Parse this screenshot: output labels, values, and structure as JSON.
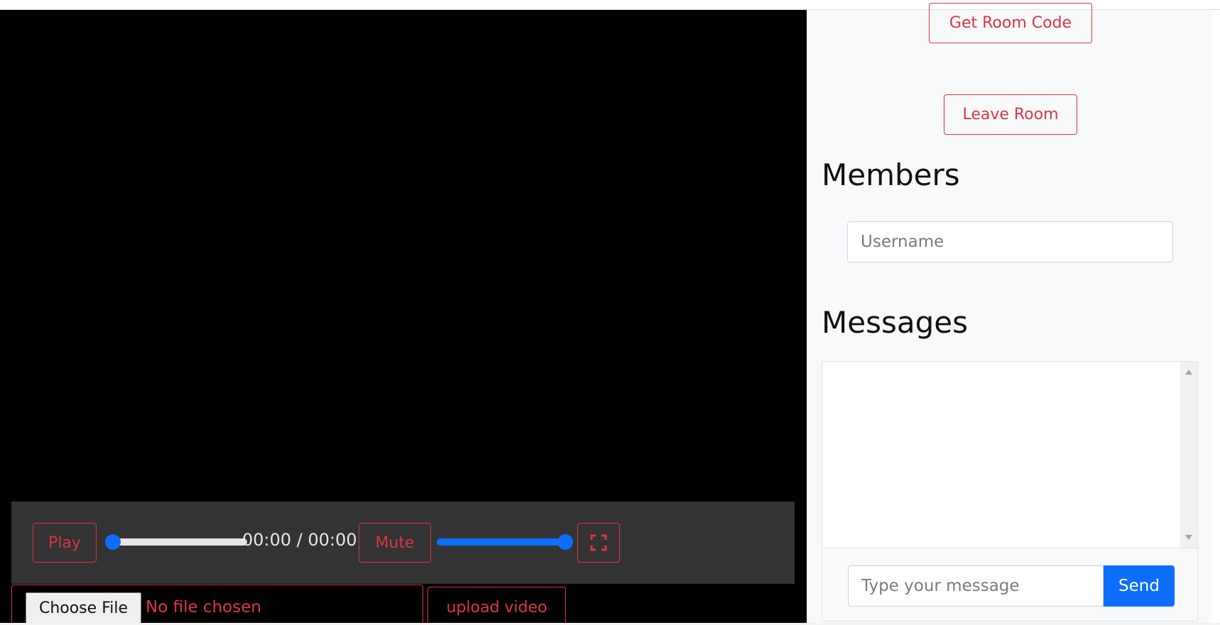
{
  "player": {
    "play_label": "Play",
    "time_display": "00:00 / 00:00",
    "mute_label": "Mute",
    "seek_progress": 0,
    "volume_level": 1.0,
    "fullscreen_icon": "fullscreen-icon"
  },
  "upload": {
    "choose_file_label": "Choose File",
    "no_file_text": "No file chosen",
    "upload_label": "upload video"
  },
  "sidebar": {
    "get_room_code_label": "Get Room Code",
    "leave_room_label": "Leave Room",
    "members_title": "Members",
    "username_placeholder": "Username",
    "messages_title": "Messages",
    "message_placeholder": "Type your message",
    "send_label": "Send"
  },
  "colors": {
    "accent_red": "#dc3545",
    "primary_blue": "#0d6efd",
    "controls_bg": "#333333"
  }
}
